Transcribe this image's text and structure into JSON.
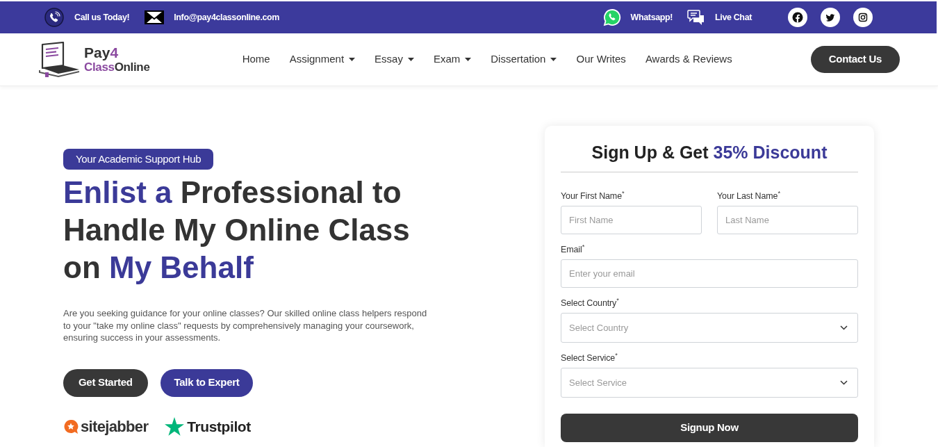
{
  "top_bar": {
    "contacts": [
      {
        "kind": "phone",
        "label": "Call us Today!"
      },
      {
        "kind": "email",
        "label": "Info@pay4classonline.com"
      }
    ],
    "channels": [
      {
        "kind": "whatsapp",
        "label": "Whatsapp!"
      },
      {
        "kind": "chat",
        "label": "Live Chat"
      }
    ],
    "social": [
      {
        "kind": "facebook"
      },
      {
        "kind": "twitter"
      },
      {
        "kind": "instagram"
      }
    ]
  },
  "nav": {
    "logo": {
      "lines": [
        [
          {
            "text": "Pay",
            "accent": false
          },
          {
            "text": "4",
            "accent": true
          }
        ],
        [
          {
            "text": "Class",
            "accent": true
          },
          {
            "text": "Online",
            "accent": false
          }
        ]
      ]
    },
    "items": [
      {
        "label": "Home",
        "dropdown": false
      },
      {
        "label": "Assignment",
        "dropdown": true
      },
      {
        "label": "Essay",
        "dropdown": true
      },
      {
        "label": "Exam",
        "dropdown": true
      },
      {
        "label": "Dissertation",
        "dropdown": true
      },
      {
        "label": "Our Writes",
        "dropdown": false
      },
      {
        "label": "Awards & Reviews",
        "dropdown": false
      }
    ],
    "cta": "Contact Us"
  },
  "hero": {
    "badge": "Your Academic Support Hub",
    "heading": [
      {
        "text": "Enlist a",
        "accent": true
      },
      {
        "text": "Professional to Handle My Online Class on",
        "accent": false
      },
      {
        "text": "My Behalf",
        "accent": true
      }
    ],
    "description": "Are you seeking guidance for your online classes? Our skilled online class helpers respond to your \"take my online class\" requests by comprehensively managing your coursework, ensuring success in your assessments.",
    "buttons": [
      {
        "kind": "dark",
        "label": "Get Started"
      },
      {
        "kind": "accent",
        "label": "Talk to Expert"
      }
    ],
    "review_sites": [
      {
        "kind": "sitejabber",
        "label": "sitejabber"
      },
      {
        "kind": "trustpilot",
        "label": "Trustpilot"
      }
    ]
  },
  "signup_form": {
    "title": [
      {
        "text": "Sign Up & Get",
        "accent": false
      },
      {
        "text": "35% Discount",
        "accent": true
      }
    ],
    "rows": [
      [
        {
          "kind": "text",
          "label": "Your First Name$^{*}$",
          "placeholder": "First Name"
        },
        {
          "kind": "text",
          "label": "Your Last Name$^{*}$",
          "placeholder": "Last Name"
        }
      ],
      [
        {
          "kind": "email",
          "label": "Email$^{*}$",
          "placeholder": "Enter your email"
        }
      ],
      [
        {
          "kind": "select",
          "label": "Select Country$^{*}$",
          "placeholder": "Select Country"
        }
      ],
      [
        {
          "kind": "select",
          "label": "Select Service$^{*}$",
          "placeholder": "Select Service"
        }
      ]
    ],
    "submit": "Signup Now"
  }
}
